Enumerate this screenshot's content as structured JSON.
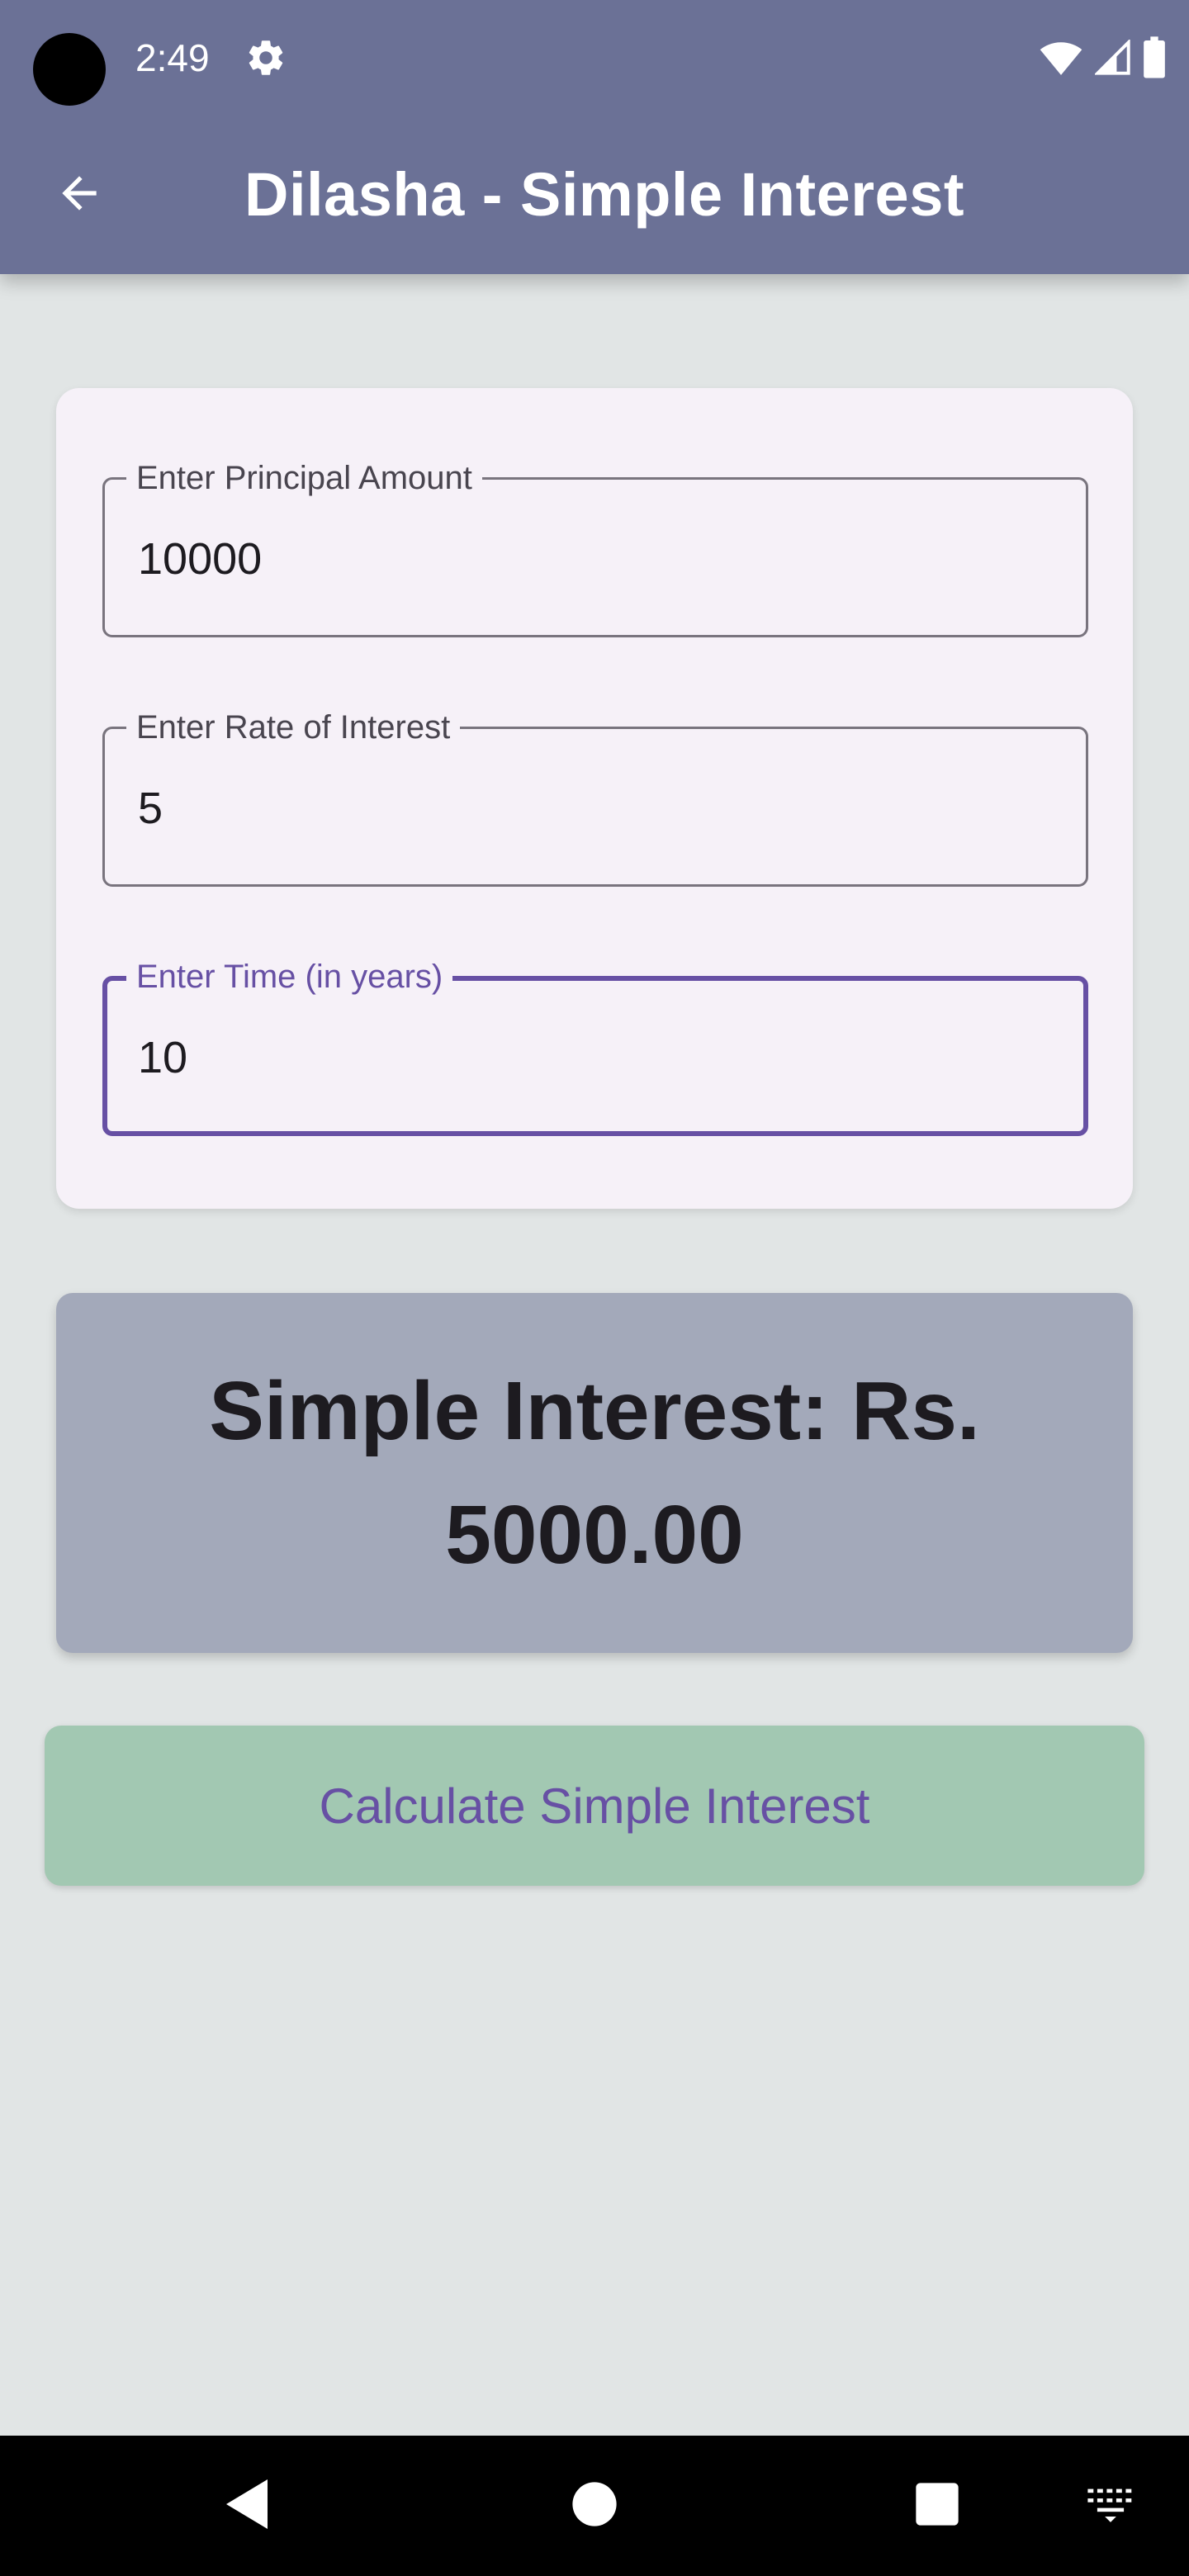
{
  "status_bar": {
    "time": "2:49",
    "icons": [
      "settings-icon",
      "wifi-icon",
      "cellular-icon",
      "battery-icon"
    ]
  },
  "app_bar": {
    "title": "Dilasha - Simple Interest",
    "back_icon": "arrow-back-icon",
    "background": "#6b7196"
  },
  "form": {
    "principal": {
      "label": "Enter Principal Amount",
      "value": "10000"
    },
    "rate": {
      "label": "Enter Rate of Interest",
      "value": "5"
    },
    "time": {
      "label": "Enter Time (in years)",
      "value": "10"
    }
  },
  "result": {
    "text": "Simple Interest: Rs. 5000.00",
    "background": "#a3a9ba"
  },
  "calculate_button": {
    "label": "Calculate Simple Interest",
    "background": "#a2c8b2",
    "text_color": "#6750a4"
  },
  "nav_bar": {
    "icons": [
      "back-triangle-icon",
      "home-circle-icon",
      "recents-square-icon",
      "keyboard-icon"
    ]
  },
  "colors": {
    "accent": "#6750a4",
    "page_background": "#e1e5e5",
    "card_background": "#f6f1f8"
  }
}
